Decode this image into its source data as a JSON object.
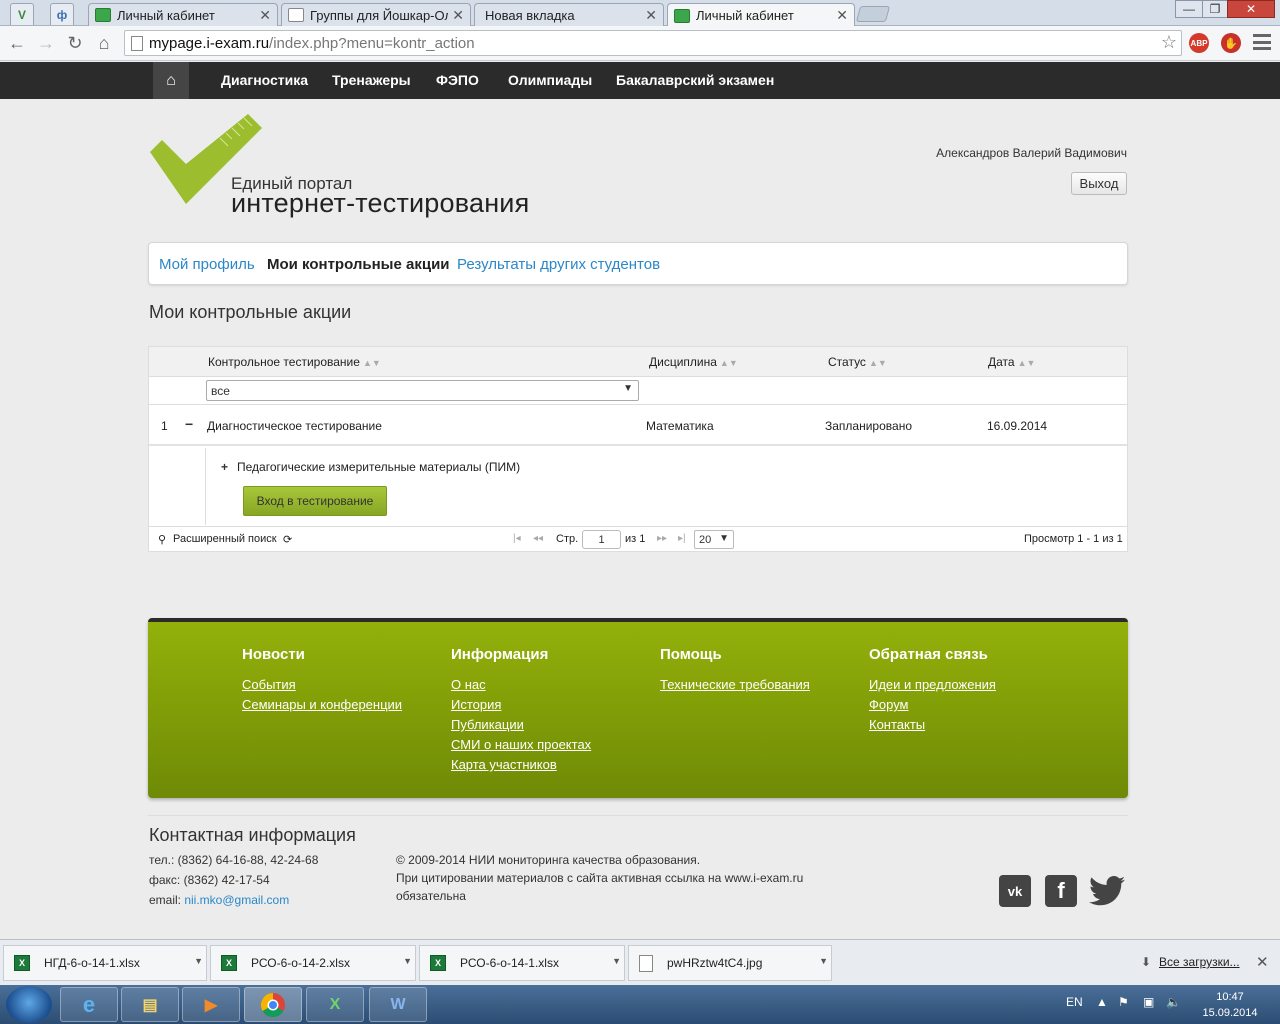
{
  "browser": {
    "tabs": [
      {
        "label": "Личный кабинет",
        "active": false
      },
      {
        "label": "Группы для Йошкар-Ол",
        "active": false
      },
      {
        "label": "Новая вкладка",
        "active": false
      },
      {
        "label": "Личный кабинет",
        "active": true
      }
    ],
    "pinned": [
      "V",
      "ф"
    ],
    "url_host": "mypage.i-exam.ru",
    "url_path": "/index.php?menu=kontr_action",
    "ext_abp": "ABP"
  },
  "sitenav": {
    "items": [
      "Диагностика",
      "Тренажеры",
      "ФЭПО",
      "Олимпиады",
      "Бакалаврский экзамен"
    ]
  },
  "header": {
    "logo_sub": "Единый портал",
    "logo_main": "интернет-тестирования",
    "user_name": "Александров Валерий Вадимович",
    "logout_label": "Выход",
    "logo_color": "#9bbd2e"
  },
  "profile_tabs": [
    {
      "label": "Мой профиль",
      "active": false
    },
    {
      "label": "Мои контрольные акции",
      "active": true
    },
    {
      "label": "Результаты других студентов",
      "active": false
    }
  ],
  "section_title": "Мои контрольные акции",
  "grid": {
    "columns": [
      "Контрольное тестирование",
      "Дисциплина",
      "Статус",
      "Дата"
    ],
    "filter_value": "все",
    "rows": [
      {
        "num": "1",
        "toggle": "−",
        "test": "Диагностическое тестирование",
        "discipline": "Математика",
        "status": "Запланировано",
        "date": "16.09.2014"
      }
    ],
    "subgrid_item": "Педагогические измерительные материалы (ПИМ)",
    "enter_button": "Вход в тестирование",
    "pager": {
      "search_label": "Расширенный поиск",
      "page_label": "Стр.",
      "page_value": "1",
      "of_label": "из 1",
      "rows_per_page": "20",
      "view_summary": "Просмотр 1 - 1 из 1"
    }
  },
  "footer": {
    "columns": [
      {
        "title": "Новости",
        "links": [
          "События",
          "Семинары и конференции"
        ]
      },
      {
        "title": "Информация",
        "links": [
          "О нас",
          "История",
          "Публикации",
          "СМИ о наших проектах",
          "Карта участников"
        ]
      },
      {
        "title": "Помощь",
        "links": [
          "Технические требования"
        ]
      },
      {
        "title": "Обратная связь",
        "links": [
          "Идеи и предложения",
          "Форум",
          "Контакты"
        ]
      }
    ],
    "contact_title": "Контактная информация",
    "phone": "тел.: (8362) 64-16-88, 42-24-68",
    "fax": "факс: (8362) 42-17-54",
    "email_label": "email: ",
    "email": "nii.mko@gmail.com",
    "copyright_1": "© 2009-2014 НИИ мониторинга качества образования.",
    "copyright_2": "При цитировании материалов с сайта активная ссылка на www.i-exam.ru",
    "copyright_3": "обязательна",
    "social": [
      "vk",
      "f"
    ],
    "green": "#86a30a"
  },
  "downloads": {
    "items": [
      "НГД-6-о-14-1.xlsx",
      "РСО-6-о-14-2.xlsx",
      "РСО-6-о-14-1.xlsx",
      "pwHRztw4tC4.jpg"
    ],
    "all_label": "Все загрузки..."
  },
  "taskbar": {
    "lang": "EN",
    "time": "10:47",
    "date": "15.09.2014"
  }
}
